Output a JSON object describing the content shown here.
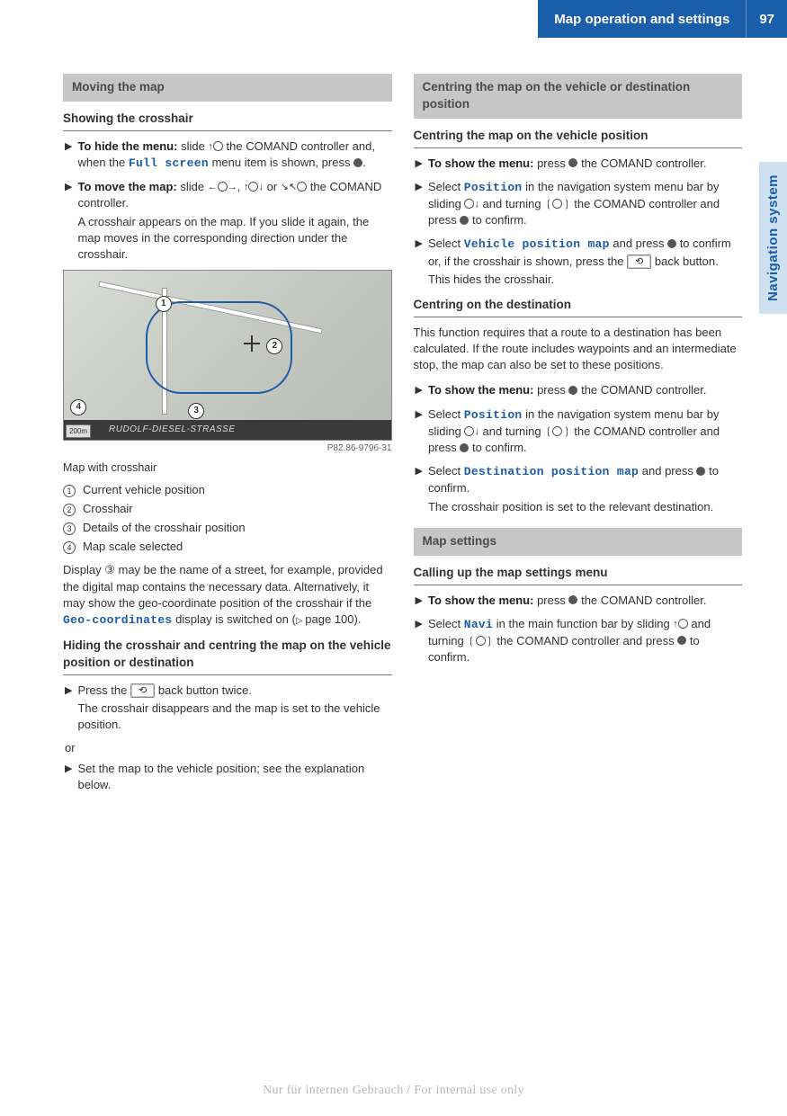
{
  "header": {
    "title": "Map operation and settings",
    "page_number": "97"
  },
  "side_tab": "Navigation system",
  "left": {
    "section1_heading": "Moving the map",
    "sub1": "Showing the crosshair",
    "step1_bold": "To hide the menu:",
    "step1_rest_a": " slide ",
    "step1_rest_b": " the COMAND controller and, when the ",
    "step1_menu": "Full screen",
    "step1_rest_c": " menu item is shown, press ",
    "step1_rest_d": ".",
    "step2_bold": "To move the map:",
    "step2_rest_a": " slide ",
    "step2_rest_b": ", ",
    "step2_rest_c": " or ",
    "step2_rest_d": " the COMAND controller.",
    "step2_follow": "A crosshair appears on the map. If you slide it again, the map moves in the corresponding direction under the crosshair.",
    "map": {
      "street": "RUDOLF-DIESEL-STRASSE",
      "scale": "200m",
      "ref": "P82.86-9796-31"
    },
    "caption": "Map with crosshair",
    "legend": [
      {
        "n": "1",
        "t": "Current vehicle position"
      },
      {
        "n": "2",
        "t": "Crosshair"
      },
      {
        "n": "3",
        "t": "Details of the crosshair position"
      },
      {
        "n": "4",
        "t": "Map scale selected"
      }
    ],
    "para_display_a": "Display ③ may be the name of a street, for example, provided the digital map contains the necessary data. Alternatively, it may show the geo-coordinate position of the crosshair if the ",
    "para_display_menu": "Geo-coordinates",
    "para_display_b": " display is switched on (",
    "para_display_pageref": "page 100",
    "para_display_c": ").",
    "sub2": "Hiding the crosshair and centring the map on the vehicle position or destination",
    "step3_a": "Press the ",
    "step3_b": " back button twice.",
    "step3_follow": "The crosshair disappears and the map is set to the vehicle position.",
    "or": "or",
    "step4": "Set the map to the vehicle position; see the explanation below."
  },
  "right": {
    "section2_heading": "Centring the map on the vehicle or destination position",
    "sub3": "Centring the map on the vehicle position",
    "r_step1_bold": "To show the menu:",
    "r_step1_rest": " press ",
    "r_step1_rest2": " the COMAND controller.",
    "r_step2_a": "Select ",
    "r_step2_menu": "Position",
    "r_step2_b": " in the navigation system menu bar by sliding ",
    "r_step2_c": " and turning ",
    "r_step2_d": " the COMAND controller and press ",
    "r_step2_e": " to confirm.",
    "r_step3_a": "Select ",
    "r_step3_menu": "Vehicle position map",
    "r_step3_b": " and press ",
    "r_step3_c": " to confirm or, if the crosshair is shown, press the ",
    "r_step3_d": " back button.",
    "r_step3_follow": "This hides the crosshair.",
    "sub4": "Centring on the destination",
    "para_dest": "This function requires that a route to a destination has been calculated. If the route includes waypoints and an intermediate stop, the map can also be set to these positions.",
    "r_step4_bold": "To show the menu:",
    "r_step4_rest": " press ",
    "r_step4_rest2": " the COMAND controller.",
    "r_step5_a": "Select ",
    "r_step5_menu": "Position",
    "r_step5_b": " in the navigation system menu bar by sliding ",
    "r_step5_c": " and turning ",
    "r_step5_d": " the COMAND controller and press ",
    "r_step5_e": " to confirm.",
    "r_step6_a": "Select ",
    "r_step6_menu": "Destination position map",
    "r_step6_b": " and press ",
    "r_step6_c": " to confirm.",
    "r_step6_follow": "The crosshair position is set to the relevant destination.",
    "section3_heading": "Map settings",
    "sub5": "Calling up the map settings menu",
    "r_step7_bold": "To show the menu:",
    "r_step7_rest": " press ",
    "r_step7_rest2": " the COMAND controller.",
    "r_step8_a": "Select ",
    "r_step8_menu": "Navi",
    "r_step8_b": " in the main function bar by sliding ",
    "r_step8_c": " and turning ",
    "r_step8_d": " the COMAND controller and press ",
    "r_step8_e": " to confirm."
  },
  "watermark": "Nur für internen Gebrauch / For internal use only",
  "icons": {
    "bullet": "▶",
    "up": "↑",
    "down": "↓",
    "left": "←",
    "right": "→",
    "diag": "↘↖",
    "back": "⟲"
  }
}
